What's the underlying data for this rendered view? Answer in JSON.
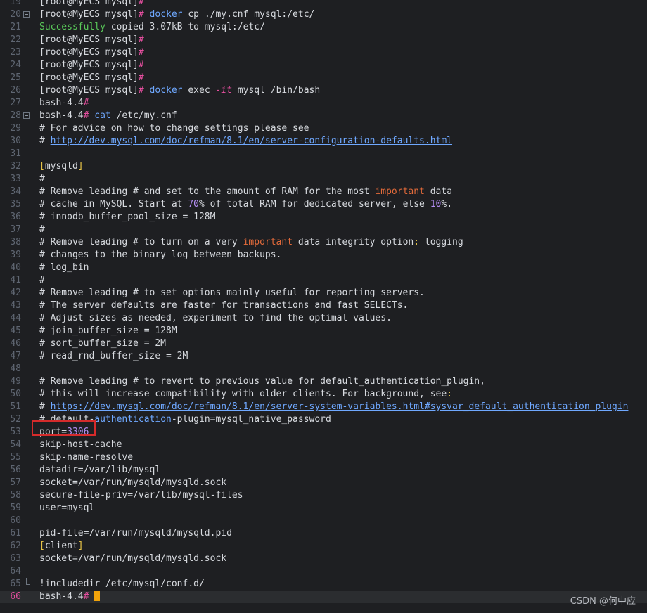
{
  "editor": {
    "lines": [
      {
        "num": "19",
        "segments": [
          [
            "dim",
            "[root@MyECS mysql]"
          ],
          [
            "hash",
            "#"
          ]
        ]
      },
      {
        "num": "20",
        "fold": "start",
        "segments": [
          [
            "dim",
            "[root@MyECS mysql]"
          ],
          [
            "hash",
            "#"
          ],
          [
            "dim",
            " "
          ],
          [
            "blue",
            "docker"
          ],
          [
            "dim",
            " cp ./my.cnf mysql:/etc/"
          ]
        ]
      },
      {
        "num": "21",
        "segments": [
          [
            "green",
            "Successfully"
          ],
          [
            "dim",
            " copied 3.07kB to mysql:/etc/"
          ]
        ]
      },
      {
        "num": "22",
        "segments": [
          [
            "dim",
            "[root@MyECS mysql]"
          ],
          [
            "hash",
            "#"
          ]
        ]
      },
      {
        "num": "23",
        "segments": [
          [
            "dim",
            "[root@MyECS mysql]"
          ],
          [
            "hash",
            "#"
          ]
        ]
      },
      {
        "num": "24",
        "segments": [
          [
            "dim",
            "[root@MyECS mysql]"
          ],
          [
            "hash",
            "#"
          ]
        ]
      },
      {
        "num": "25",
        "segments": [
          [
            "dim",
            "[root@MyECS mysql]"
          ],
          [
            "hash",
            "#"
          ]
        ]
      },
      {
        "num": "26",
        "segments": [
          [
            "dim",
            "[root@MyECS mysql]"
          ],
          [
            "hash",
            "#"
          ],
          [
            "dim",
            " "
          ],
          [
            "blue",
            "docker"
          ],
          [
            "dim",
            " exec "
          ],
          [
            "italic",
            "-it"
          ],
          [
            "dim",
            " mysql /bin/bash"
          ]
        ]
      },
      {
        "num": "27",
        "segments": [
          [
            "dim",
            "bash-4.4"
          ],
          [
            "hash",
            "#"
          ]
        ]
      },
      {
        "num": "28",
        "fold": "start",
        "segments": [
          [
            "dim",
            "bash-4.4"
          ],
          [
            "hash",
            "#"
          ],
          [
            "dim",
            " "
          ],
          [
            "blue",
            "cat"
          ],
          [
            "dim",
            " /etc/my.cnf"
          ]
        ]
      },
      {
        "num": "29",
        "segments": [
          [
            "dim",
            "# For advice on how to change settings please see"
          ]
        ]
      },
      {
        "num": "30",
        "segments": [
          [
            "dim",
            "# "
          ],
          [
            "link",
            "http://dev.mysql.com/doc/refman/8.1/en/server-configuration-defaults.html"
          ]
        ]
      },
      {
        "num": "31",
        "segments": []
      },
      {
        "num": "32",
        "segments": [
          [
            "yellow",
            "["
          ],
          [
            "dim",
            "mysqld"
          ],
          [
            "yellow",
            "]"
          ]
        ]
      },
      {
        "num": "33",
        "segments": [
          [
            "dim",
            "#"
          ]
        ]
      },
      {
        "num": "34",
        "segments": [
          [
            "dim",
            "# Remove leading # and set to the amount of RAM for the most "
          ],
          [
            "orange",
            "important"
          ],
          [
            "dim",
            " data"
          ]
        ]
      },
      {
        "num": "35",
        "segments": [
          [
            "dim",
            "# cache in MySQL. Start at "
          ],
          [
            "purple",
            "70"
          ],
          [
            "dim",
            "% of total RAM for dedicated server, else "
          ],
          [
            "purple",
            "10"
          ],
          [
            "dim",
            "%."
          ]
        ]
      },
      {
        "num": "36",
        "segments": [
          [
            "dim",
            "# innodb_buffer_pool_size = 128M"
          ]
        ]
      },
      {
        "num": "37",
        "segments": [
          [
            "dim",
            "#"
          ]
        ]
      },
      {
        "num": "38",
        "segments": [
          [
            "dim",
            "# Remove leading # to turn on a very "
          ],
          [
            "orange",
            "important"
          ],
          [
            "dim",
            " data integrity option"
          ],
          [
            "yellow",
            ":"
          ],
          [
            "dim",
            " logging"
          ]
        ]
      },
      {
        "num": "39",
        "segments": [
          [
            "dim",
            "# changes to the binary log between backups."
          ]
        ]
      },
      {
        "num": "40",
        "segments": [
          [
            "dim",
            "# log_bin"
          ]
        ]
      },
      {
        "num": "41",
        "segments": [
          [
            "dim",
            "#"
          ]
        ]
      },
      {
        "num": "42",
        "segments": [
          [
            "dim",
            "# Remove leading # to set options mainly useful for reporting servers."
          ]
        ]
      },
      {
        "num": "43",
        "segments": [
          [
            "dim",
            "# The server defaults are faster for transactions and fast SELECTs."
          ]
        ]
      },
      {
        "num": "44",
        "segments": [
          [
            "dim",
            "# Adjust sizes as needed, experiment to find the optimal values."
          ]
        ]
      },
      {
        "num": "45",
        "segments": [
          [
            "dim",
            "# join_buffer_size = 128M"
          ]
        ]
      },
      {
        "num": "46",
        "segments": [
          [
            "dim",
            "# sort_buffer_size = 2M"
          ]
        ]
      },
      {
        "num": "47",
        "segments": [
          [
            "dim",
            "# read_rnd_buffer_size = 2M"
          ]
        ]
      },
      {
        "num": "48",
        "segments": []
      },
      {
        "num": "49",
        "segments": [
          [
            "dim",
            "# Remove leading # to revert to previous value for default_authentication_plugin,"
          ]
        ]
      },
      {
        "num": "50",
        "segments": [
          [
            "dim",
            "# this will increase compatibility with older clients. For background, see"
          ],
          [
            "yellow",
            ":"
          ]
        ]
      },
      {
        "num": "51",
        "segments": [
          [
            "dim",
            "# "
          ],
          [
            "link",
            "https://dev.mysql.com/doc/refman/8.1/en/server-system-variables.html#sysvar_default_authentication_plugin"
          ]
        ]
      },
      {
        "num": "52",
        "segments": [
          [
            "dim",
            "# default-"
          ],
          [
            "blue",
            "authentication"
          ],
          [
            "dim",
            "-plugin=mysql_native_password"
          ]
        ]
      },
      {
        "num": "53",
        "segments": [
          [
            "dim",
            "port="
          ],
          [
            "purple",
            "3306"
          ]
        ]
      },
      {
        "num": "54",
        "segments": [
          [
            "dim",
            "skip-host-cache"
          ]
        ]
      },
      {
        "num": "55",
        "segments": [
          [
            "dim",
            "skip-name-resolve"
          ]
        ]
      },
      {
        "num": "56",
        "segments": [
          [
            "dim",
            "datadir=/var/lib/mysql"
          ]
        ]
      },
      {
        "num": "57",
        "segments": [
          [
            "dim",
            "socket=/var/run/mysqld/mysqld.sock"
          ]
        ]
      },
      {
        "num": "58",
        "segments": [
          [
            "dim",
            "secure-file-priv=/var/lib/mysql-files"
          ]
        ]
      },
      {
        "num": "59",
        "segments": [
          [
            "dim",
            "user=mysql"
          ]
        ]
      },
      {
        "num": "60",
        "segments": []
      },
      {
        "num": "61",
        "segments": [
          [
            "dim",
            "pid-file=/var/run/mysqld/mysqld.pid"
          ]
        ]
      },
      {
        "num": "62",
        "segments": [
          [
            "yellow",
            "["
          ],
          [
            "dim",
            "client"
          ],
          [
            "yellow",
            "]"
          ]
        ]
      },
      {
        "num": "63",
        "segments": [
          [
            "dim",
            "socket=/var/run/mysqld/mysqld.sock"
          ]
        ]
      },
      {
        "num": "64",
        "segments": []
      },
      {
        "num": "65",
        "fold": "end",
        "segments": [
          [
            "dim",
            "!includedir /etc/mysql/conf.d/"
          ]
        ]
      },
      {
        "num": "66",
        "current": true,
        "cursor": true,
        "segments": [
          [
            "dim",
            "bash-4.4"
          ],
          [
            "hash",
            "#"
          ]
        ]
      }
    ]
  },
  "watermark": "CSDN @何中应",
  "colors": {
    "background": "#1e1f22",
    "text": "#d7dadf",
    "prompt_hash": "#e54f9f",
    "command": "#6fa8ff",
    "success": "#59c859",
    "number": "#b48ef4",
    "keyword_important": "#e26a3a",
    "highlight_box": "#d52b2b",
    "cursor": "#f0a30a"
  }
}
